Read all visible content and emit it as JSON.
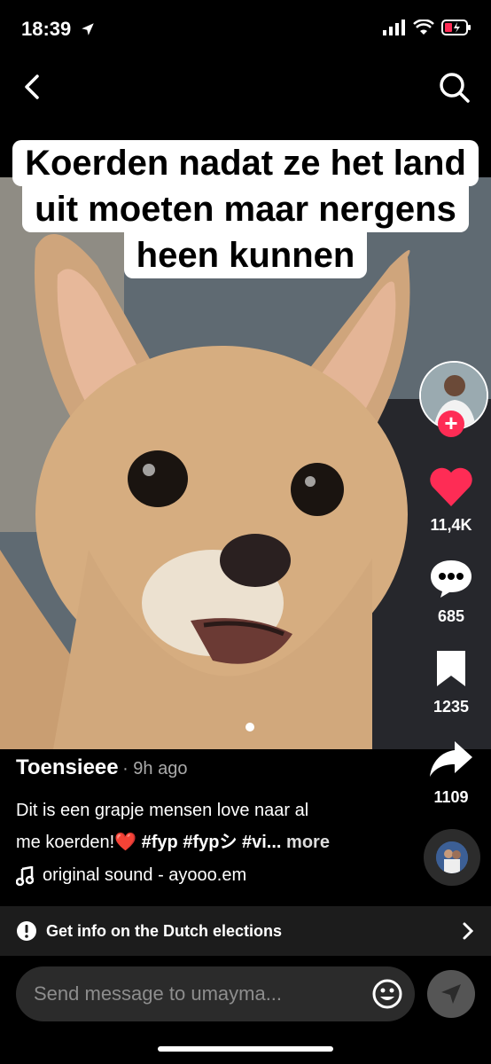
{
  "status": {
    "time": "18:39"
  },
  "caption": {
    "lines": [
      "Koerden nadat ze het land",
      "uit moeten maar nergens",
      "heen kunnen"
    ]
  },
  "creator": {
    "username": "Toensieee",
    "posted": "· 9h ago"
  },
  "actions": {
    "likes": "11,4K",
    "comments": "685",
    "saves": "1235",
    "shares": "1109"
  },
  "description": {
    "line1": "Dit is een grapje mensen love naar al",
    "line2_text": "me koerden!",
    "heart_emoji": "❤️",
    "hashtags": "#fyp #fypシ #vi...",
    "more": "more"
  },
  "sound": {
    "label": "original sound - ayooo.em"
  },
  "banner": {
    "text": "Get info on the Dutch elections"
  },
  "message": {
    "placeholder": "Send message to umayma..."
  },
  "colors": {
    "like": "#fe2c55",
    "background": "#000000",
    "banner": "#1c1c1c"
  },
  "icons": [
    "location-arrow-icon",
    "signal-icon",
    "wifi-icon",
    "battery-icon",
    "back-icon",
    "search-icon",
    "heart-icon",
    "comment-icon",
    "bookmark-icon",
    "share-icon",
    "info-icon",
    "chevron-right-icon",
    "music-note-icon",
    "emoji-icon",
    "send-icon"
  ]
}
